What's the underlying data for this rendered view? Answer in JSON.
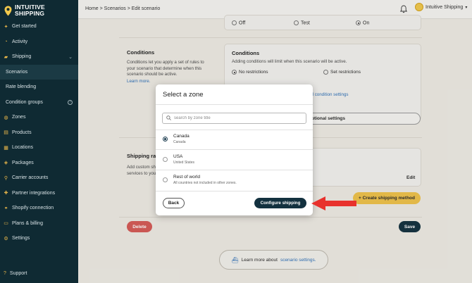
{
  "brand": {
    "line1": "INTUITIVE",
    "line2": "SHIPPING"
  },
  "sidebar": {
    "items": [
      {
        "label": "Get started",
        "icon": "rocket-icon",
        "glyph": "✦"
      },
      {
        "label": "Activity",
        "icon": "activity-icon",
        "glyph": "◔"
      },
      {
        "label": "Shipping",
        "icon": "shipping-icon",
        "glyph": "▰",
        "chevron": "⌄"
      },
      {
        "label": "Scenarios",
        "sub": true,
        "active": true
      },
      {
        "label": "Rate blending",
        "sub": true
      },
      {
        "label": "Condition groups",
        "sub": true,
        "help": "?"
      },
      {
        "label": "Zones",
        "icon": "zones-icon",
        "glyph": "◍"
      },
      {
        "label": "Products",
        "icon": "products-icon",
        "glyph": "▤"
      },
      {
        "label": "Locations",
        "icon": "locations-icon",
        "glyph": "▦"
      },
      {
        "label": "Packages",
        "icon": "packages-icon",
        "glyph": "◈"
      },
      {
        "label": "Carrier accounts",
        "icon": "carrier-icon",
        "glyph": "⚲"
      },
      {
        "label": "Partner integrations",
        "icon": "partner-icon",
        "glyph": "✚"
      },
      {
        "label": "Shopify connection",
        "icon": "shopify-icon",
        "glyph": "⚭"
      },
      {
        "label": "Plans & billing",
        "icon": "billing-icon",
        "glyph": "▭"
      },
      {
        "label": "Settings",
        "icon": "settings-icon",
        "glyph": "⚙"
      }
    ],
    "support": "Support"
  },
  "topbar": {
    "breadcrumb": "Home > Scenarios > Edit scenario",
    "account": "Intuitive Shipping"
  },
  "background": {
    "top_radios": [
      "Off",
      "Test",
      "On"
    ],
    "conditions": {
      "heading": "Conditions",
      "description": "Conditions let you apply a set of rules to your scenario that determine when this scenario should be active.",
      "learn_more": "Learn more.",
      "card_heading": "Conditions",
      "card_text": "Adding conditions will limit when this scenario will be active.",
      "radio_no": "No restrictions",
      "radio_set": "Set restrictions",
      "advanced_link": "ced condition settings",
      "optional_btn": "optional settings"
    },
    "shipping_rates": {
      "heading": "Shipping rat",
      "desc_line1": "Add custom sh",
      "desc_line2": "services to you",
      "edit": "Edit",
      "create_btn": "+ Create shipping method"
    },
    "delete_btn": "Delete",
    "save_btn": "Save",
    "learn_more_prefix": "Learn more about",
    "learn_more_link": "scenario settings."
  },
  "modal": {
    "title": "Select a zone",
    "search_placeholder": "search by zone title",
    "options": [
      {
        "title": "Canada",
        "subtitle": "Canada",
        "selected": true
      },
      {
        "title": "USA",
        "subtitle": "United States",
        "selected": false
      },
      {
        "title": "Rest of world",
        "subtitle": "All countries not included in other zones.",
        "selected": false
      }
    ],
    "back_label": "Back",
    "confirm_label": "Configure shipping"
  },
  "colors": {
    "sidebar_bg": "#0f2a33",
    "accent_yellow": "#f2c94c",
    "primary_dark": "#13313f",
    "arrow_red": "#e8322d",
    "delete_red": "#d9534f"
  }
}
